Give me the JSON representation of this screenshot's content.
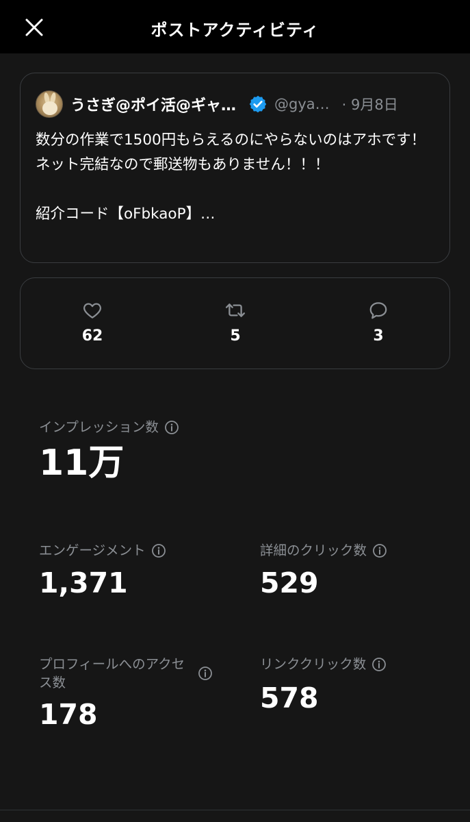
{
  "header": {
    "title": "ポストアクティビティ"
  },
  "post": {
    "author_name": "うさぎ@ポイ活@ギャ…",
    "handle": "@gya…",
    "date": "· 9月8日",
    "body": "数分の作業で1500円もらえるのにやらないのはアホです！\nネット完結なので郵送物もありません！！！\n\n紹介コード【oFbkaoP】…"
  },
  "engagement": {
    "likes": "62",
    "reposts": "5",
    "replies": "3"
  },
  "metrics": {
    "impressions": {
      "label": "インプレッション数",
      "value": "11万"
    },
    "engagements": {
      "label": "エンゲージメント",
      "value": "1,371"
    },
    "detail_clicks": {
      "label": "詳細のクリック数",
      "value": "529"
    },
    "profile_visits": {
      "label": "プロフィールへのアクセス数",
      "value": "178"
    },
    "link_clicks": {
      "label": "リンククリック数",
      "value": "578"
    }
  },
  "colors": {
    "background": "#161616",
    "header": "#000000",
    "muted": "#8b8f94",
    "verified": "#1d9bf0",
    "border": "#3a3d40"
  },
  "icons": [
    "close-icon",
    "verified-badge-icon",
    "heart-icon",
    "repost-icon",
    "reply-icon",
    "info-icon"
  ]
}
